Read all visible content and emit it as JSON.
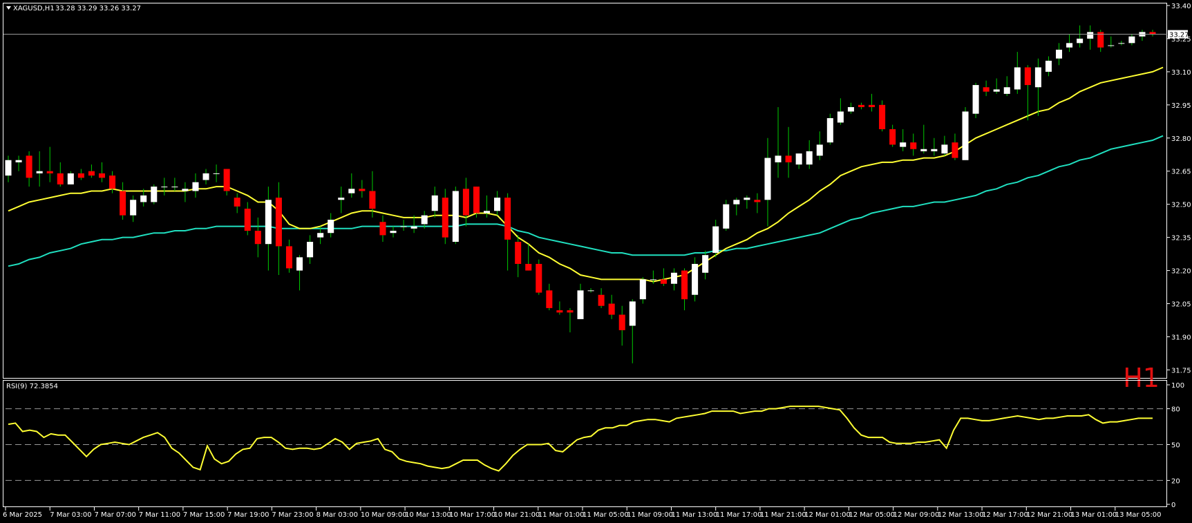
{
  "main_header": {
    "symbol": "XAGUSD,H1",
    "ohlc": "33.28 33.29 33.26 33.27"
  },
  "timeframe_label": "H1",
  "current_price_label": "33.27",
  "rsi_header": "RSI(9) 72.3854",
  "colors": {
    "background": "#000000",
    "frame": "#ffffff",
    "bull_candle": "#ffffff",
    "bear_candle": "#ff0000",
    "wick": "#00cc00",
    "ma_fast": "#ffff33",
    "ma_slow": "#20e0c0",
    "rsi_line": "#ffff33",
    "rsi_levels": "#9a9a9a",
    "timeframe_label": "#e01010"
  },
  "chart_data": [
    {
      "type": "candlestick",
      "symbol": "XAGUSD",
      "timeframe": "H1",
      "price_axis_ticks": [
        33.4,
        33.25,
        33.1,
        32.95,
        32.8,
        32.65,
        32.5,
        32.35,
        32.2,
        32.05,
        31.9,
        31.75
      ],
      "price_axis_range": [
        31.72,
        33.4
      ],
      "current_price": 33.27,
      "time_axis_labels": [
        "6 Mar 2025",
        "7 Mar 03:00",
        "7 Mar 07:00",
        "7 Mar 11:00",
        "7 Mar 15:00",
        "7 Mar 19:00",
        "7 Mar 23:00",
        "8 Mar 03:00",
        "10 Mar 09:00",
        "10 Mar 13:00",
        "10 Mar 17:00",
        "10 Mar 21:00",
        "11 Mar 01:00",
        "11 Mar 05:00",
        "11 Mar 09:00",
        "11 Mar 13:00",
        "11 Mar 17:00",
        "11 Mar 21:00",
        "12 Mar 01:00",
        "12 Mar 05:00",
        "12 Mar 09:00",
        "12 Mar 13:00",
        "12 Mar 17:00",
        "12 Mar 21:00",
        "13 Mar 01:00",
        "13 Mar 05:00"
      ],
      "candles": [
        {
          "o": 32.63,
          "h": 32.72,
          "l": 32.6,
          "c": 32.7
        },
        {
          "o": 32.69,
          "h": 32.72,
          "l": 32.65,
          "c": 32.7
        },
        {
          "o": 32.72,
          "h": 32.74,
          "l": 32.58,
          "c": 32.62
        },
        {
          "o": 32.64,
          "h": 32.74,
          "l": 32.58,
          "c": 32.65
        },
        {
          "o": 32.65,
          "h": 32.76,
          "l": 32.6,
          "c": 32.64
        },
        {
          "o": 32.64,
          "h": 32.69,
          "l": 32.58,
          "c": 32.59
        },
        {
          "o": 32.59,
          "h": 32.65,
          "l": 32.59,
          "c": 32.64
        },
        {
          "o": 32.64,
          "h": 32.66,
          "l": 32.61,
          "c": 32.62
        },
        {
          "o": 32.65,
          "h": 32.68,
          "l": 32.62,
          "c": 32.63
        },
        {
          "o": 32.64,
          "h": 32.69,
          "l": 32.6,
          "c": 32.62
        },
        {
          "o": 32.63,
          "h": 32.65,
          "l": 32.55,
          "c": 32.57
        },
        {
          "o": 32.56,
          "h": 32.6,
          "l": 32.43,
          "c": 32.45
        },
        {
          "o": 32.45,
          "h": 32.54,
          "l": 32.42,
          "c": 32.52
        },
        {
          "o": 32.51,
          "h": 32.57,
          "l": 32.49,
          "c": 32.54
        },
        {
          "o": 32.51,
          "h": 32.59,
          "l": 32.5,
          "c": 32.58
        },
        {
          "o": 32.58,
          "h": 32.62,
          "l": 32.54,
          "c": 32.58
        },
        {
          "o": 32.58,
          "h": 32.62,
          "l": 32.56,
          "c": 32.58
        },
        {
          "o": 32.56,
          "h": 32.6,
          "l": 32.51,
          "c": 32.57
        },
        {
          "o": 32.56,
          "h": 32.64,
          "l": 32.53,
          "c": 32.6
        },
        {
          "o": 32.61,
          "h": 32.66,
          "l": 32.59,
          "c": 32.64
        },
        {
          "o": 32.64,
          "h": 32.68,
          "l": 32.6,
          "c": 32.64
        },
        {
          "o": 32.66,
          "h": 32.66,
          "l": 32.54,
          "c": 32.56
        },
        {
          "o": 32.53,
          "h": 32.55,
          "l": 32.46,
          "c": 32.49
        },
        {
          "o": 32.48,
          "h": 32.51,
          "l": 32.36,
          "c": 32.38
        },
        {
          "o": 32.38,
          "h": 32.44,
          "l": 32.26,
          "c": 32.32
        },
        {
          "o": 32.32,
          "h": 32.58,
          "l": 32.2,
          "c": 32.52
        },
        {
          "o": 32.53,
          "h": 32.6,
          "l": 32.18,
          "c": 32.31
        },
        {
          "o": 32.31,
          "h": 32.34,
          "l": 32.19,
          "c": 32.21
        },
        {
          "o": 32.2,
          "h": 32.27,
          "l": 32.11,
          "c": 32.26
        },
        {
          "o": 32.26,
          "h": 32.36,
          "l": 32.23,
          "c": 32.33
        },
        {
          "o": 32.35,
          "h": 32.4,
          "l": 32.32,
          "c": 32.37
        },
        {
          "o": 32.37,
          "h": 32.46,
          "l": 32.35,
          "c": 32.43
        },
        {
          "o": 32.52,
          "h": 32.58,
          "l": 32.46,
          "c": 32.53
        },
        {
          "o": 32.55,
          "h": 32.64,
          "l": 32.53,
          "c": 32.57
        },
        {
          "o": 32.57,
          "h": 32.61,
          "l": 32.53,
          "c": 32.56
        },
        {
          "o": 32.56,
          "h": 32.65,
          "l": 32.44,
          "c": 32.48
        },
        {
          "o": 32.42,
          "h": 32.45,
          "l": 32.33,
          "c": 32.36
        },
        {
          "o": 32.37,
          "h": 32.4,
          "l": 32.35,
          "c": 32.38
        },
        {
          "o": 32.4,
          "h": 32.43,
          "l": 32.38,
          "c": 32.4
        },
        {
          "o": 32.39,
          "h": 32.45,
          "l": 32.37,
          "c": 32.4
        },
        {
          "o": 32.41,
          "h": 32.47,
          "l": 32.39,
          "c": 32.45
        },
        {
          "o": 32.47,
          "h": 32.58,
          "l": 32.44,
          "c": 32.54
        },
        {
          "o": 32.53,
          "h": 32.57,
          "l": 32.32,
          "c": 32.35
        },
        {
          "o": 32.33,
          "h": 32.58,
          "l": 32.32,
          "c": 32.56
        },
        {
          "o": 32.57,
          "h": 32.62,
          "l": 32.4,
          "c": 32.45
        },
        {
          "o": 32.58,
          "h": 32.58,
          "l": 32.44,
          "c": 32.46
        },
        {
          "o": 32.46,
          "h": 32.54,
          "l": 32.44,
          "c": 32.47
        },
        {
          "o": 32.47,
          "h": 32.56,
          "l": 32.45,
          "c": 32.53
        },
        {
          "o": 32.53,
          "h": 32.55,
          "l": 32.2,
          "c": 32.34
        },
        {
          "o": 32.33,
          "h": 32.36,
          "l": 32.17,
          "c": 32.23
        },
        {
          "o": 32.23,
          "h": 32.32,
          "l": 32.2,
          "c": 32.2
        },
        {
          "o": 32.23,
          "h": 32.25,
          "l": 32.09,
          "c": 32.1
        },
        {
          "o": 32.11,
          "h": 32.14,
          "l": 32.02,
          "c": 32.03
        },
        {
          "o": 32.02,
          "h": 32.06,
          "l": 32.0,
          "c": 32.01
        },
        {
          "o": 32.02,
          "h": 32.03,
          "l": 31.92,
          "c": 32.01
        },
        {
          "o": 31.98,
          "h": 32.14,
          "l": 31.98,
          "c": 32.11
        },
        {
          "o": 32.11,
          "h": 32.12,
          "l": 32.1,
          "c": 32.11
        },
        {
          "o": 32.09,
          "h": 32.12,
          "l": 32.03,
          "c": 32.04
        },
        {
          "o": 32.05,
          "h": 32.09,
          "l": 31.98,
          "c": 32.0
        },
        {
          "o": 32.0,
          "h": 32.04,
          "l": 31.86,
          "c": 31.93
        },
        {
          "o": 31.95,
          "h": 32.07,
          "l": 31.78,
          "c": 32.06
        },
        {
          "o": 32.07,
          "h": 32.17,
          "l": 32.05,
          "c": 32.16
        },
        {
          "o": 32.16,
          "h": 32.2,
          "l": 32.14,
          "c": 32.16
        },
        {
          "o": 32.16,
          "h": 32.21,
          "l": 32.13,
          "c": 32.14
        },
        {
          "o": 32.14,
          "h": 32.21,
          "l": 32.11,
          "c": 32.19
        },
        {
          "o": 32.2,
          "h": 32.21,
          "l": 32.02,
          "c": 32.07
        },
        {
          "o": 32.09,
          "h": 32.26,
          "l": 32.06,
          "c": 32.23
        },
        {
          "o": 32.19,
          "h": 32.29,
          "l": 32.16,
          "c": 32.27
        },
        {
          "o": 32.28,
          "h": 32.43,
          "l": 32.26,
          "c": 32.4
        },
        {
          "o": 32.39,
          "h": 32.52,
          "l": 32.38,
          "c": 32.5
        },
        {
          "o": 32.5,
          "h": 32.53,
          "l": 32.45,
          "c": 32.52
        },
        {
          "o": 32.52,
          "h": 32.54,
          "l": 32.48,
          "c": 32.53
        },
        {
          "o": 32.52,
          "h": 32.55,
          "l": 32.46,
          "c": 32.51
        },
        {
          "o": 32.52,
          "h": 32.8,
          "l": 32.4,
          "c": 32.71
        },
        {
          "o": 32.69,
          "h": 32.94,
          "l": 32.62,
          "c": 32.72
        },
        {
          "o": 32.72,
          "h": 32.85,
          "l": 32.62,
          "c": 32.69
        },
        {
          "o": 32.68,
          "h": 32.73,
          "l": 32.66,
          "c": 32.73
        },
        {
          "o": 32.68,
          "h": 32.79,
          "l": 32.66,
          "c": 32.74
        },
        {
          "o": 32.72,
          "h": 32.83,
          "l": 32.7,
          "c": 32.77
        },
        {
          "o": 32.78,
          "h": 32.91,
          "l": 32.77,
          "c": 32.89
        },
        {
          "o": 32.87,
          "h": 32.98,
          "l": 32.86,
          "c": 32.92
        },
        {
          "o": 32.92,
          "h": 32.96,
          "l": 32.91,
          "c": 32.94
        },
        {
          "o": 32.95,
          "h": 32.96,
          "l": 32.93,
          "c": 32.94
        },
        {
          "o": 32.95,
          "h": 33.0,
          "l": 32.92,
          "c": 32.94
        },
        {
          "o": 32.95,
          "h": 32.97,
          "l": 32.83,
          "c": 32.84
        },
        {
          "o": 32.84,
          "h": 32.86,
          "l": 32.76,
          "c": 32.77
        },
        {
          "o": 32.76,
          "h": 32.84,
          "l": 32.74,
          "c": 32.78
        },
        {
          "o": 32.78,
          "h": 32.82,
          "l": 32.72,
          "c": 32.75
        },
        {
          "o": 32.74,
          "h": 32.86,
          "l": 32.73,
          "c": 32.75
        },
        {
          "o": 32.74,
          "h": 32.8,
          "l": 32.72,
          "c": 32.75
        },
        {
          "o": 32.73,
          "h": 32.81,
          "l": 32.72,
          "c": 32.77
        },
        {
          "o": 32.78,
          "h": 32.82,
          "l": 32.7,
          "c": 32.71
        },
        {
          "o": 32.7,
          "h": 32.94,
          "l": 32.7,
          "c": 32.92
        },
        {
          "o": 32.91,
          "h": 33.05,
          "l": 32.89,
          "c": 33.04
        },
        {
          "o": 33.03,
          "h": 33.06,
          "l": 32.99,
          "c": 33.01
        },
        {
          "o": 33.01,
          "h": 33.07,
          "l": 33.0,
          "c": 33.02
        },
        {
          "o": 33.0,
          "h": 33.08,
          "l": 32.99,
          "c": 33.03
        },
        {
          "o": 33.02,
          "h": 33.19,
          "l": 33.0,
          "c": 33.12
        },
        {
          "o": 33.12,
          "h": 33.13,
          "l": 32.88,
          "c": 33.04
        },
        {
          "o": 33.03,
          "h": 33.16,
          "l": 32.9,
          "c": 33.12
        },
        {
          "o": 33.1,
          "h": 33.17,
          "l": 33.08,
          "c": 33.15
        },
        {
          "o": 33.16,
          "h": 33.23,
          "l": 33.13,
          "c": 33.2
        },
        {
          "o": 33.21,
          "h": 33.27,
          "l": 33.19,
          "c": 33.23
        },
        {
          "o": 33.23,
          "h": 33.31,
          "l": 33.21,
          "c": 33.25
        },
        {
          "o": 33.25,
          "h": 33.31,
          "l": 33.2,
          "c": 33.28
        },
        {
          "o": 33.28,
          "h": 33.29,
          "l": 33.19,
          "c": 33.21
        },
        {
          "o": 33.22,
          "h": 33.26,
          "l": 33.21,
          "c": 33.22
        },
        {
          "o": 33.23,
          "h": 33.24,
          "l": 33.22,
          "c": 33.23
        },
        {
          "o": 33.23,
          "h": 33.27,
          "l": 33.22,
          "c": 33.26
        },
        {
          "o": 33.26,
          "h": 33.29,
          "l": 33.24,
          "c": 33.28
        },
        {
          "o": 33.28,
          "h": 33.29,
          "l": 33.26,
          "c": 33.27
        }
      ],
      "ma_fast": [
        32.47,
        32.49,
        32.51,
        32.52,
        32.53,
        32.54,
        32.55,
        32.55,
        32.56,
        32.56,
        32.57,
        32.56,
        32.56,
        32.56,
        32.56,
        32.56,
        32.56,
        32.56,
        32.57,
        32.57,
        32.58,
        32.58,
        32.56,
        32.54,
        32.51,
        32.51,
        32.47,
        32.41,
        32.39,
        32.39,
        32.4,
        32.42,
        32.44,
        32.46,
        32.47,
        32.47,
        32.46,
        32.45,
        32.44,
        32.44,
        32.44,
        32.45,
        32.45,
        32.45,
        32.44,
        32.46,
        32.46,
        32.45,
        32.4,
        32.35,
        32.32,
        32.28,
        32.26,
        32.23,
        32.21,
        32.18,
        32.17,
        32.16,
        32.16,
        32.16,
        32.16,
        32.16,
        32.15,
        32.16,
        32.17,
        32.18,
        32.21,
        32.24,
        32.27,
        32.3,
        32.32,
        32.34,
        32.37,
        32.39,
        32.42,
        32.46,
        32.49,
        32.52,
        32.56,
        32.59,
        32.63,
        32.65,
        32.67,
        32.68,
        32.69,
        32.69,
        32.7,
        32.7,
        32.71,
        32.71,
        32.72,
        32.74,
        32.77,
        32.8,
        32.82,
        32.84,
        32.86,
        32.88,
        32.9,
        32.92,
        32.93,
        32.96,
        32.98,
        33.01,
        33.03,
        33.05,
        33.06,
        33.07,
        33.08,
        33.09,
        33.1,
        33.12
      ],
      "ma_slow": [
        32.22,
        32.23,
        32.25,
        32.26,
        32.28,
        32.29,
        32.3,
        32.32,
        32.33,
        32.34,
        32.34,
        32.35,
        32.35,
        32.36,
        32.37,
        32.37,
        32.38,
        32.38,
        32.39,
        32.39,
        32.4,
        32.4,
        32.4,
        32.4,
        32.4,
        32.4,
        32.39,
        32.39,
        32.39,
        32.39,
        32.39,
        32.39,
        32.39,
        32.39,
        32.4,
        32.4,
        32.4,
        32.4,
        32.4,
        32.4,
        32.4,
        32.4,
        32.4,
        32.4,
        32.41,
        32.41,
        32.41,
        32.41,
        32.4,
        32.38,
        32.37,
        32.35,
        32.34,
        32.33,
        32.32,
        32.31,
        32.3,
        32.29,
        32.28,
        32.28,
        32.27,
        32.27,
        32.27,
        32.27,
        32.27,
        32.27,
        32.28,
        32.28,
        32.29,
        32.29,
        32.3,
        32.3,
        32.31,
        32.32,
        32.33,
        32.34,
        32.35,
        32.36,
        32.37,
        32.39,
        32.41,
        32.43,
        32.44,
        32.46,
        32.47,
        32.48,
        32.49,
        32.49,
        32.5,
        32.51,
        32.51,
        32.52,
        32.53,
        32.54,
        32.56,
        32.57,
        32.59,
        32.6,
        32.62,
        32.63,
        32.65,
        32.67,
        32.68,
        32.7,
        32.71,
        32.73,
        32.75,
        32.76,
        32.77,
        32.78,
        32.79,
        32.81
      ]
    },
    {
      "type": "line",
      "indicator": "RSI(9)",
      "value": 72.3854,
      "y_axis_ticks": [
        100,
        80,
        50,
        20,
        0
      ],
      "y_range": [
        0,
        100
      ],
      "levels": [
        80,
        50,
        20
      ],
      "values": [
        67,
        68,
        61,
        62,
        61,
        56,
        59,
        58,
        58,
        52,
        46,
        40,
        46,
        50,
        51,
        52,
        51,
        50,
        53,
        56,
        58,
        60,
        56,
        47,
        43,
        37,
        31,
        29,
        49,
        38,
        34,
        36,
        42,
        46,
        47,
        55,
        56,
        56,
        52,
        47,
        46,
        47,
        47,
        46,
        47,
        51,
        55,
        52,
        46,
        51,
        52,
        53,
        55,
        46,
        44,
        38,
        36,
        35,
        34,
        32,
        31,
        30,
        31,
        34,
        37,
        37,
        37,
        33,
        30,
        28,
        34,
        41,
        46,
        50,
        50,
        50,
        51,
        45,
        44,
        49,
        54,
        56,
        57,
        62,
        64,
        64,
        66,
        66,
        69,
        70,
        71,
        71,
        70,
        69,
        72,
        73,
        74,
        75,
        76,
        78,
        78,
        78,
        78,
        76,
        77,
        78,
        78,
        80,
        80,
        81,
        82,
        82,
        82,
        82,
        82,
        81,
        80,
        79,
        72,
        64,
        58,
        56,
        56,
        56,
        52,
        51,
        51,
        51,
        52,
        52,
        53,
        54,
        47,
        62,
        72,
        72,
        71,
        70,
        70,
        71,
        72,
        73,
        74,
        73,
        72,
        71,
        72,
        72,
        73,
        74,
        74,
        74,
        75,
        71,
        68,
        69,
        69,
        70,
        71,
        72,
        72,
        72
      ]
    }
  ]
}
